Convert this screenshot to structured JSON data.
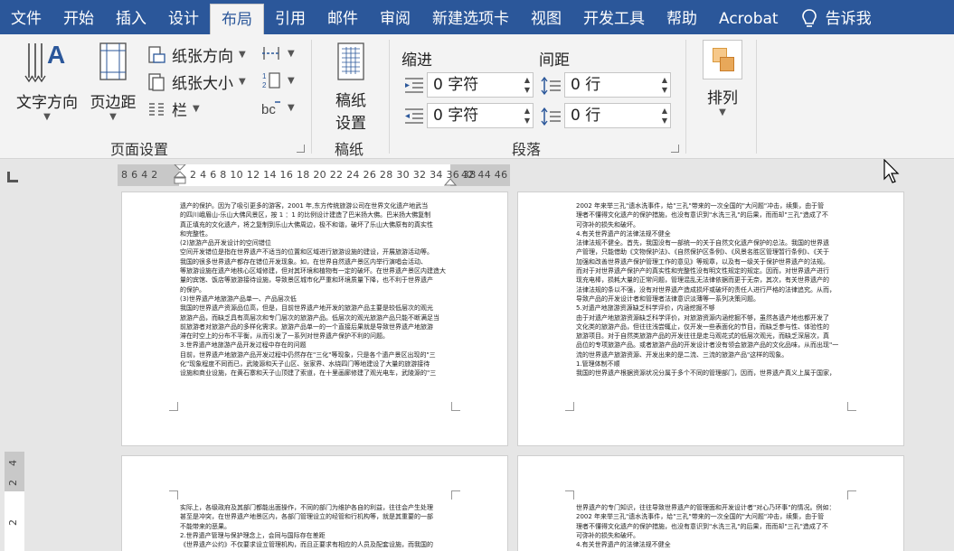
{
  "tabs": [
    "文件",
    "开始",
    "插入",
    "设计",
    "布局",
    "引用",
    "邮件",
    "审阅",
    "新建选项卡",
    "视图",
    "开发工具",
    "帮助",
    "Acrobat"
  ],
  "active_tab": "布局",
  "tell_me": "告诉我",
  "ribbon": {
    "page_setup": {
      "label": "页面设置",
      "text_direction": "文字方向",
      "margins": "页边距",
      "orientation": "纸张方向",
      "size": "纸张大小",
      "columns": "栏"
    },
    "draft": {
      "label": "稿纸",
      "btn_line1": "稿纸",
      "btn_line2": "设置"
    },
    "paragraph": {
      "label": "段落",
      "indent_label": "缩进",
      "spacing_label": "间距",
      "indent_left": "0 字符",
      "indent_right": "0 字符",
      "space_before": "0 行",
      "space_after": "0 行"
    },
    "arrange": {
      "label": "排列"
    }
  },
  "ruler": {
    "left_numbers": "8 6 4 2",
    "main_numbers": "2 4 6 8 10 12 14 16 18 20 22 24 26 28 30 32 34 36 38",
    "right_numbers": "42 44 46"
  },
  "vruler": [
    "4",
    "2",
    "2"
  ],
  "pages": {
    "top_left": [
      "遗产的保护。因为了吸引更多的游客，2001 年,东方传统旅游公司在世界文化遗产地武当",
      "的四川峨眉山-乐山大佛风景区，按 1 ：1 的比例设计建造了巴米扬大佛。巴米扬大佛复制",
      "真正填充的文化遗产，将之复制到乐山大佛周边，极不和谐，破坏了乐山大佛原有的真实性",
      "和完整性。",
      "(2)旅游产品开发设计的空间错位",
      "空间开发错位是指在世界遗产不适当的位置和区域进行旅游设施的建设，开展旅游活动等。",
      "我国的很多世界遗产都存在错位开发现象。如，在世界自然遗产景区内举行演唱会活动、",
      "等旅游设施在遗产地核心区域修建，但对其环境和植物有一定的破坏。在世界遗产景区内建造大",
      "量的宾馆、饭店等旅游接待设施，导致景区城市化严重和环境质量下降，也不利于世界遗产",
      "的保护。",
      "(3)世界遗产地旅游产品单一、产品层次低",
      "我国的世界遗产资源品位高，但是，目前世界遗产地开发的旅游产品主要是较低层次的观光",
      "旅游产品，而缺乏具有高层次和专门层次的旅游产品。低层次的观光旅游产品只能不断满足当",
      "前旅游者对旅游产品的多样化需求。旅游产品单一的一个直接后果就是导致世界遗产地旅游",
      "滞在时空上的分布不平衡，从而引发了一系列对世界遗产保护不利的问题。",
      "3.世界遗产地旅游产品开发过程中存在的问题",
      "目前，世界遗产地旅游产品开发过程中仍然存在\"三化\"等现象，只是各个遗产景区出现的\"三",
      "化\"现象程度不同而已，武陵源和天子山区、张家界、水绕四门等地建设了大量的旅游接待",
      "设施和商业设施，在黄石寨和天子山顶建了索道，在十里画廊修建了观光电车，武陵源的\"三"
    ],
    "top_right": [
      "2002 年来举三孔\"遗水洗事件，给\"三孔\"带来的一次全国的\"大问题\"冲击，续集，由于管",
      "理者不懂得文化遗产的保护措施，也没有意识到\"水洗三孔\"的后果，而而却\"三孔\"造成了不",
      "可弥补的损失和破坏。",
      "4.有关世界遗产的法律法规不健全",
      "法律法规不健全。首先，我国没有一部统一的关于自然文化遗产保护的总法。我国的世界遗",
      "产管理，只能借助《文物保护法》、《自然保护区条例》、《风景名胜区管理暂行条例》、《关于",
      "加强和改善世界遗产保护管理工作的意见》等规章，以及有一级关于保护世界遗产的法规。",
      "而对于对世界遗产保护产的真实性和完整性没有明文性规定的规定。因而，对世界遗产进行",
      "现充电棒，损耗大量的正常问题，管理混乱无法律依据而更于无奈，其次，有关世界遗产的",
      "法律法规的条以不强，没有对世界遗产造成损坏或破坏的责任人进行严格的法律追究。从而，",
      "导致产品的开发设计者和管理者法律意识淡薄等一系列决策问题。",
      "5.对遗产地旅游资源缺乏科学评价，内涵挖掘不够",
      "由于对遗产地旅游资源缺乏科学评价，对旅游资源内涵挖掘不够，虽然各遗产地也都开发了",
      "文化类的旅游产品，但往往浅尝辄止，仅开发一些表面化的节目，而缺乏参与性、体验性的",
      "旅游项目。对于自然类旅游产品的开发往往是走马观花式的低层次观光，而缺乏深层次，真",
      "品位的专项旅游产品。或者旅游产品的开发设计者没有领会旅游产品的文化品味，从而出现\"一",
      "流的世界遗产旅游资源、开发出来的是二流、三流的旅游产品\"这样的现象。",
      "1.管理体制不顺",
      "我国的世界遗产根据资源状况分属于多个不同的管理部门，因而，世界遗产真义上属于国家，"
    ],
    "bottom_left": [
      "实际上，各级政府及其部门都能出面操作，不同的部门为维护各自的利益，往往会产生处理",
      "甚至是冲突，在世界遗产地景区内，各部门管理设立的经管和行机构等，就是其重要的一部",
      "不能带来的恶果。",
      "2.世界遗产管理与保护理念上，会同与国际存在差距",
      "《世界遗产公约》不仅要求设立管理机构，而且正要求有相应的人员及配套设施，而我国的"
    ],
    "bottom_right": [
      "世界遗产的专门知识，往往导致世界遗产的管理面和开发设计者\"对心乃环事\"的情况。例如：",
      "2002 年来举三孔\"遗水洗事件，给\"三孔\"带来的一次全国的\"大问题\"冲击，续集，由于管",
      "理者不懂得文化遗产的保护措施，也没有意识到\"水洗三孔\"的后果，而而却\"三孔\"造成了不",
      "可弥补的损失和破坏。",
      "4.有关世界遗产的法律法规不健全"
    ]
  }
}
